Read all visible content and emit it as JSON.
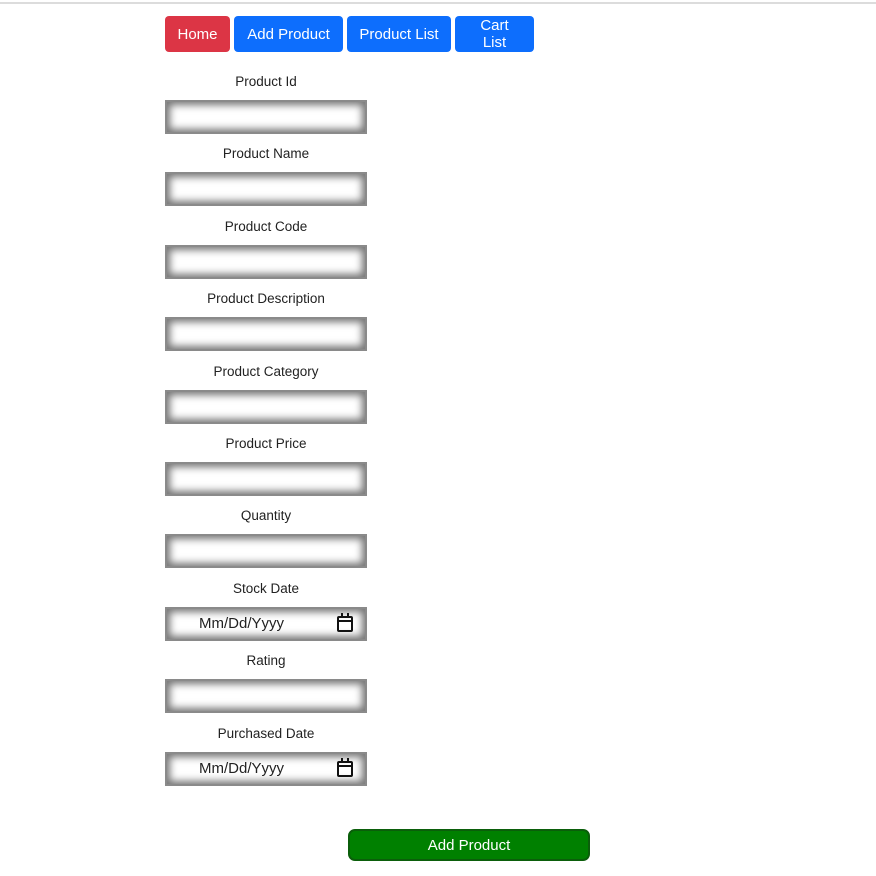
{
  "nav": {
    "home": "Home",
    "add_product": "Add Product",
    "product_list": "Product List",
    "cart_list": "Cart List"
  },
  "form": {
    "fields": [
      {
        "label": "Product Id",
        "type": "text",
        "value": ""
      },
      {
        "label": "Product Name",
        "type": "text",
        "value": ""
      },
      {
        "label": "Product Code",
        "type": "text",
        "value": ""
      },
      {
        "label": "Product Description",
        "type": "text",
        "value": ""
      },
      {
        "label": "Product Category",
        "type": "text",
        "value": ""
      },
      {
        "label": "Product Price",
        "type": "text",
        "value": ""
      },
      {
        "label": "Quantity",
        "type": "text",
        "value": ""
      },
      {
        "label": "Stock Date",
        "type": "date",
        "placeholder": "Mm/Dd/Yyyy"
      },
      {
        "label": "Rating",
        "type": "text",
        "value": ""
      },
      {
        "label": "Purchased Date",
        "type": "date",
        "placeholder": "Mm/Dd/Yyyy"
      }
    ],
    "submit_label": "Add Product"
  },
  "colors": {
    "home": "#dc3545",
    "nav_primary": "#0d6efd",
    "submit": "#008000"
  },
  "icons": {
    "date_picker": "calendar-icon"
  }
}
